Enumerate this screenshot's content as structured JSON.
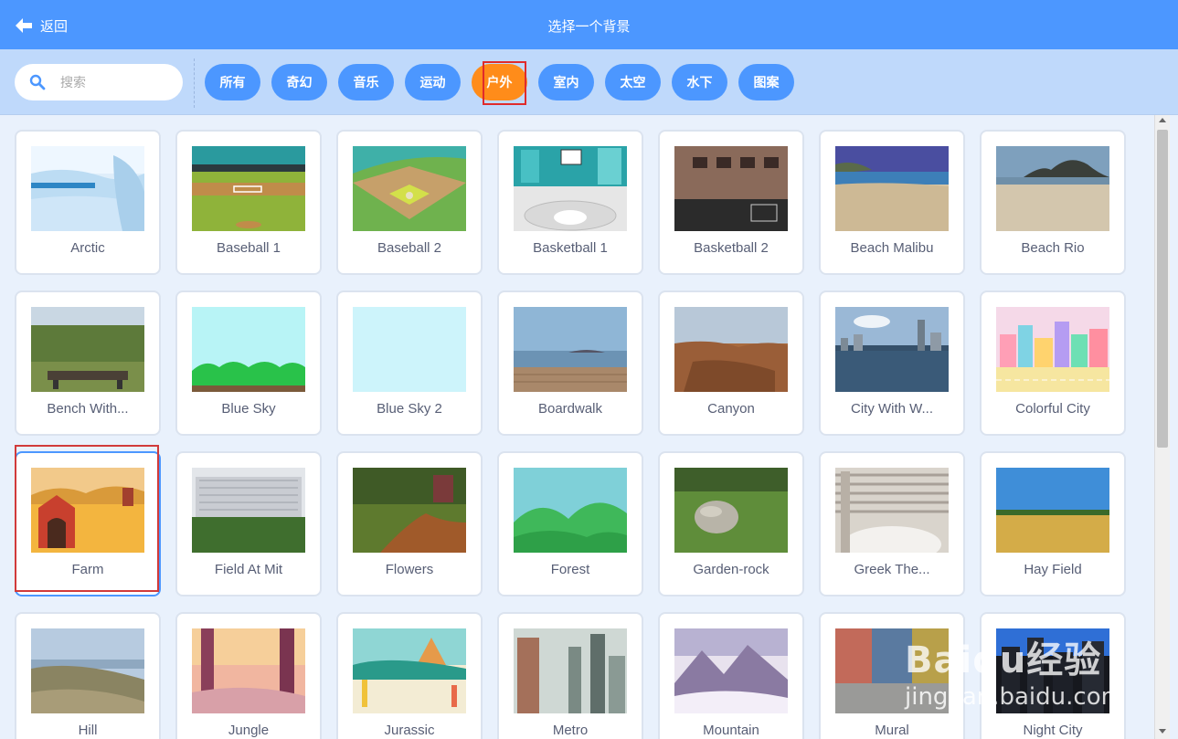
{
  "header": {
    "back_label": "返回",
    "title": "选择一个背景"
  },
  "search": {
    "placeholder": "搜索"
  },
  "tags": [
    {
      "label": "所有",
      "active": false
    },
    {
      "label": "奇幻",
      "active": false
    },
    {
      "label": "音乐",
      "active": false
    },
    {
      "label": "运动",
      "active": false
    },
    {
      "label": "户外",
      "active": true
    },
    {
      "label": "室内",
      "active": false
    },
    {
      "label": "太空",
      "active": false
    },
    {
      "label": "水下",
      "active": false
    },
    {
      "label": "图案",
      "active": false
    }
  ],
  "backdrops": [
    {
      "name": "Arctic"
    },
    {
      "name": "Baseball 1"
    },
    {
      "name": "Baseball 2"
    },
    {
      "name": "Basketball 1"
    },
    {
      "name": "Basketball 2"
    },
    {
      "name": "Beach Malibu"
    },
    {
      "name": "Beach Rio"
    },
    {
      "name": "Bench With..."
    },
    {
      "name": "Blue Sky"
    },
    {
      "name": "Blue Sky 2"
    },
    {
      "name": "Boardwalk"
    },
    {
      "name": "Canyon"
    },
    {
      "name": "City With W..."
    },
    {
      "name": "Colorful City"
    },
    {
      "name": "Farm",
      "selected": true
    },
    {
      "name": "Field At Mit"
    },
    {
      "name": "Flowers"
    },
    {
      "name": "Forest"
    },
    {
      "name": "Garden-rock"
    },
    {
      "name": "Greek The..."
    },
    {
      "name": "Hay Field"
    },
    {
      "name": "Hill"
    },
    {
      "name": "Jungle"
    },
    {
      "name": "Jurassic"
    },
    {
      "name": "Metro"
    },
    {
      "name": "Mountain"
    },
    {
      "name": "Mural"
    },
    {
      "name": "Night City"
    }
  ],
  "watermark": {
    "brand": "Baidu经验",
    "url": "jingyan.baidu.com"
  },
  "colors": {
    "header": "#4c97ff",
    "filter_bar": "#bfd9fb",
    "active_tag": "#ff8c1a",
    "highlight": "#d13a3a",
    "page": "#e9f1fc"
  }
}
